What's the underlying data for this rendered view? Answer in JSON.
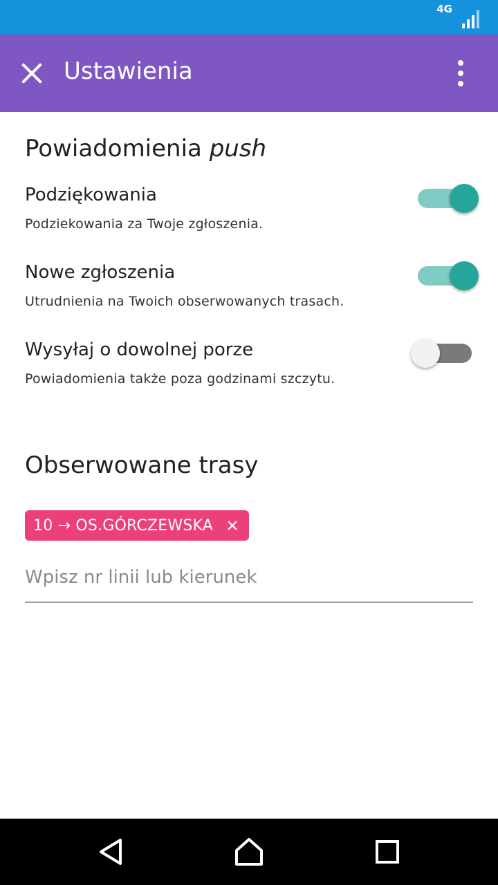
{
  "status_bar": {
    "network": "4G"
  },
  "app_bar": {
    "title": "Ustawienia"
  },
  "push_section": {
    "title": "Powiadomienia ",
    "title_emphasis": "push",
    "settings": [
      {
        "label": "Podziękowania",
        "description": "Podziekowania za Twoje zgłoszenia.",
        "enabled": true
      },
      {
        "label": "Nowe zgłoszenia",
        "description": "Utrudnienia na Twoich obserwowanych trasach.",
        "enabled": true
      },
      {
        "label": "Wysyłaj o dowolnej porze",
        "description": "Powiadomienia także poza godzinami szczytu.",
        "enabled": false
      }
    ]
  },
  "routes_section": {
    "title": "Obserwowane trasy",
    "chips": [
      {
        "label": "10 → OS.GÓRCZEWSKA"
      }
    ],
    "input_placeholder": "Wpisz nr linii lub kierunek"
  },
  "colors": {
    "status_bar": "#1592db",
    "app_bar": "#7e57c2",
    "switch_on": "#26a69a",
    "chip": "#ec407a"
  }
}
